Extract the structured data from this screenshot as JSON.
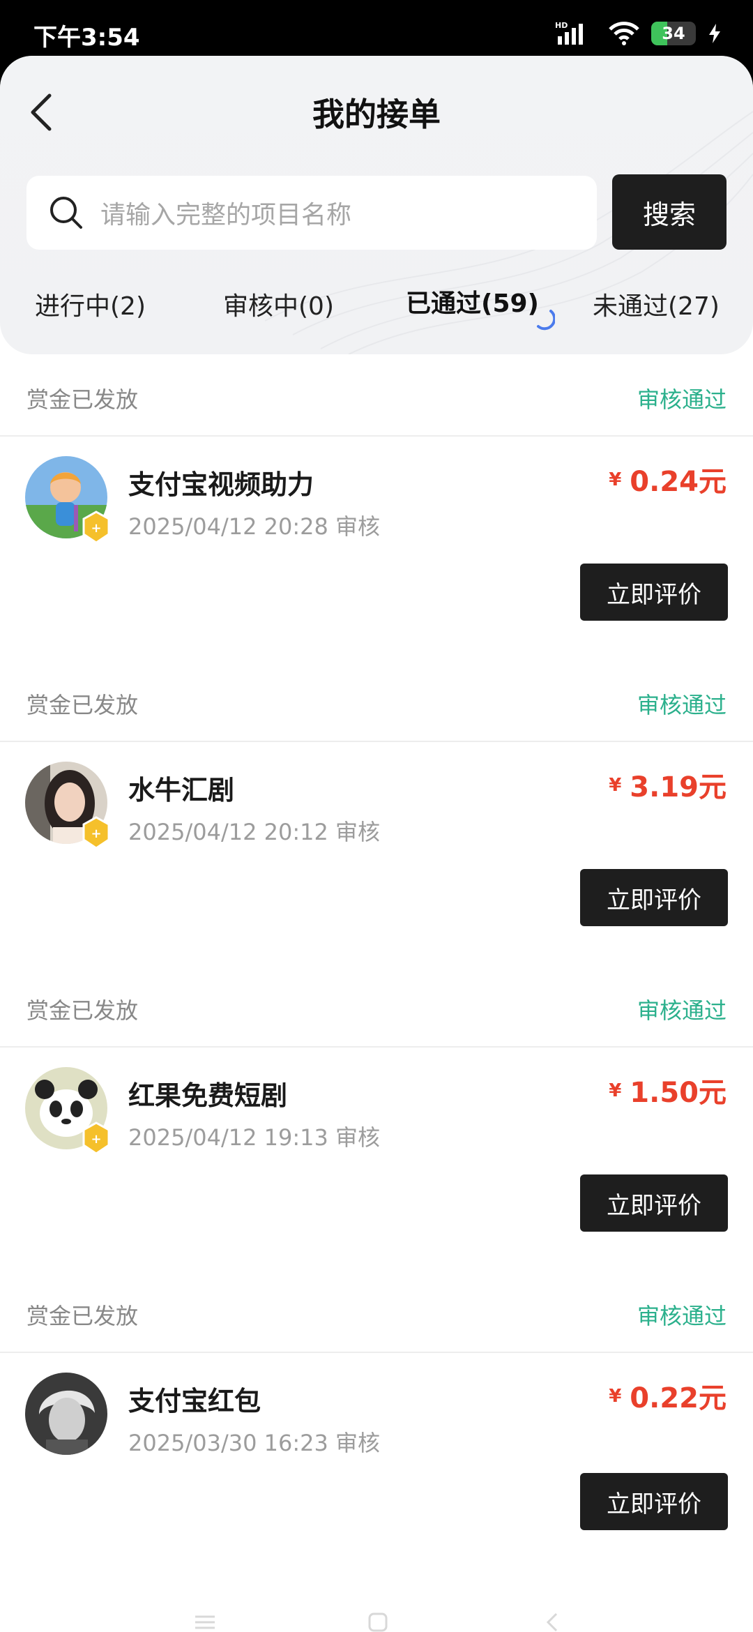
{
  "status_bar": {
    "time": "下午3:54",
    "battery": "34"
  },
  "header": {
    "title": "我的接单"
  },
  "search": {
    "placeholder": "请输入完整的项目名称",
    "button": "搜索"
  },
  "tabs": [
    {
      "label": "进行中(2)",
      "active": false
    },
    {
      "label": "审核中(0)",
      "active": false
    },
    {
      "label": "已通过(59)",
      "active": true
    },
    {
      "label": "未通过(27)",
      "active": false
    }
  ],
  "orders": [
    {
      "status_left": "赏金已发放",
      "status_right": "审核通过",
      "title": "支付宝视频助力",
      "time": "2025/04/12 20:28 审核",
      "currency": "¥",
      "price": "0.24元",
      "action": "立即评价"
    },
    {
      "status_left": "赏金已发放",
      "status_right": "审核通过",
      "title": "水牛汇剧",
      "time": "2025/04/12 20:12 审核",
      "currency": "¥",
      "price": "3.19元",
      "action": "立即评价"
    },
    {
      "status_left": "赏金已发放",
      "status_right": "审核通过",
      "title": "红果免费短剧",
      "time": "2025/04/12 19:13 审核",
      "currency": "¥",
      "price": "1.50元",
      "action": "立即评价"
    },
    {
      "status_left": "赏金已发放",
      "status_right": "审核通过",
      "title": "支付宝红包",
      "time": "2025/03/30 16:23 审核",
      "currency": "¥",
      "price": "0.22元",
      "action": "立即评价"
    }
  ],
  "colors": {
    "accent_price": "#e9402b",
    "status_ok": "#2bb08c",
    "button_dark": "#1e1e1e"
  }
}
